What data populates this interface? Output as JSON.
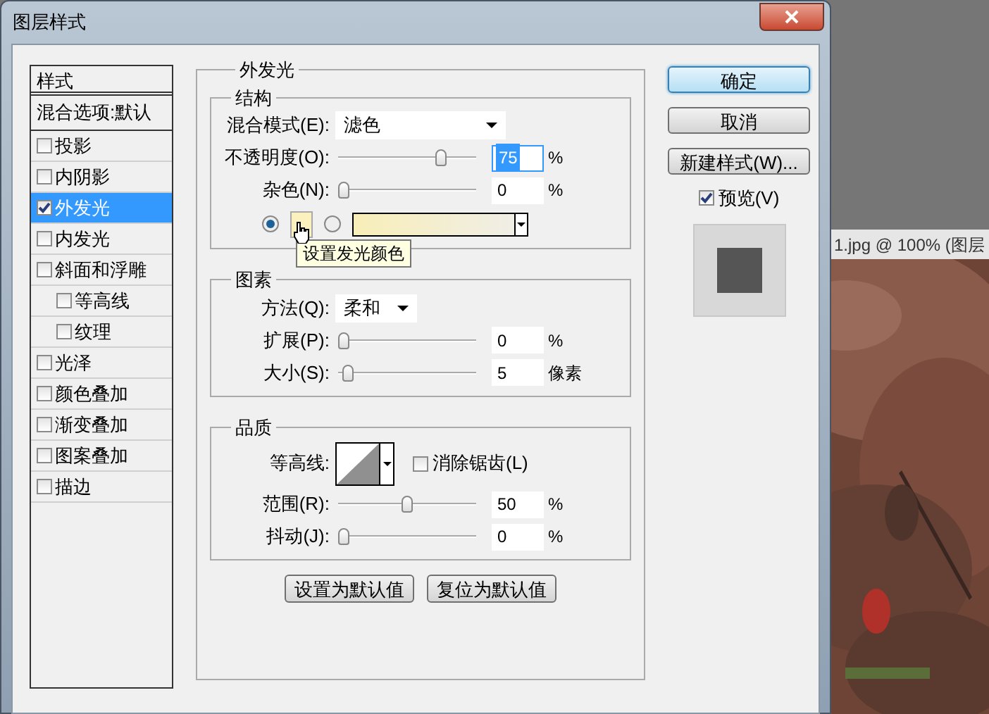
{
  "window": {
    "title": "图层样式"
  },
  "styles_list": {
    "header": "样式",
    "items": [
      {
        "label": "混合选项:默认",
        "kind": "plain",
        "selected": false
      },
      {
        "label": "投影",
        "kind": "checkbox",
        "checked": false,
        "selected": false
      },
      {
        "label": "内阴影",
        "kind": "checkbox",
        "checked": false,
        "selected": false
      },
      {
        "label": "外发光",
        "kind": "checkbox",
        "checked": true,
        "selected": true
      },
      {
        "label": "内发光",
        "kind": "checkbox",
        "checked": false,
        "selected": false
      },
      {
        "label": "斜面和浮雕",
        "kind": "checkbox",
        "checked": false,
        "selected": false,
        "children": [
          {
            "label": "等高线",
            "kind": "checkbox",
            "checked": false,
            "selected": false
          },
          {
            "label": "纹理",
            "kind": "checkbox",
            "checked": false,
            "selected": false
          }
        ]
      },
      {
        "label": "光泽",
        "kind": "checkbox",
        "checked": false,
        "selected": false
      },
      {
        "label": "颜色叠加",
        "kind": "checkbox",
        "checked": false,
        "selected": false
      },
      {
        "label": "渐变叠加",
        "kind": "checkbox",
        "checked": false,
        "selected": false
      },
      {
        "label": "图案叠加",
        "kind": "checkbox",
        "checked": false,
        "selected": false
      },
      {
        "label": "描边",
        "kind": "checkbox",
        "checked": false,
        "selected": false
      }
    ]
  },
  "panel": {
    "title": "外发光",
    "groups": [
      {
        "title": "结构",
        "rows": [
          {
            "kind": "dropdown",
            "label": "混合模式(E):",
            "value": "滤色"
          },
          {
            "kind": "slider",
            "label": "不透明度(O):",
            "level": 0.77,
            "value": "75",
            "unit": "%",
            "focused": true
          },
          {
            "kind": "slider",
            "label": "杂色(N):",
            "level": 0,
            "value": "0",
            "unit": "%",
            "focused": false
          },
          {
            "kind": "fill",
            "options": [
              {
                "kind": "swatch",
                "selected": true
              },
              {
                "kind": "gradient",
                "selected": false
              }
            ],
            "tooltip": "设置发光颜色"
          }
        ]
      },
      {
        "title": "图素",
        "rows": [
          {
            "kind": "dropdown",
            "label": "方法(Q):",
            "value": "柔和"
          },
          {
            "kind": "slider",
            "label": "扩展(P):",
            "level": 0,
            "value": "0",
            "unit": "%",
            "focused": false
          },
          {
            "kind": "slider",
            "label": "大小(S):",
            "level": 0.03,
            "value": "5",
            "unit": "像素",
            "focused": false
          }
        ]
      },
      {
        "title": "品质",
        "rows": [
          {
            "kind": "contour",
            "label": "等高线:",
            "anti_alias": {
              "label": "消除锯齿(L)",
              "checked": false
            }
          },
          {
            "kind": "slider",
            "label": "范围(R):",
            "level": 0.5,
            "value": "50",
            "unit": "%",
            "focused": false
          },
          {
            "kind": "slider",
            "label": "抖动(J):",
            "level": 0,
            "value": "0",
            "unit": "%",
            "focused": false
          }
        ]
      }
    ],
    "buttons": [
      "设置为默认值",
      "复位为默认值"
    ]
  },
  "side_buttons": [
    {
      "label": "确定",
      "default": true
    },
    {
      "label": "取消",
      "default": false
    },
    {
      "label": "新建样式(W)...",
      "default": false
    }
  ],
  "preview": {
    "label": "预览(V)",
    "checked": true
  },
  "document": {
    "title": "1.jpg @ 100% (图层"
  }
}
